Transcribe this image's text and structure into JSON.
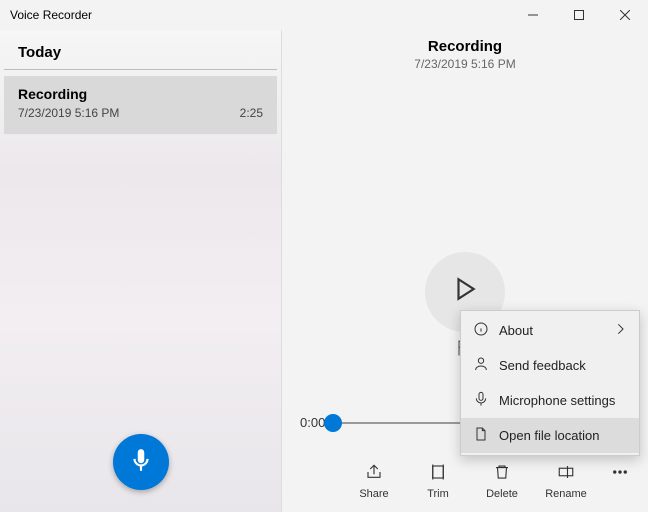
{
  "app_title": "Voice Recorder",
  "sidebar": {
    "group_label": "Today",
    "items": [
      {
        "title": "Recording",
        "subtitle": "7/23/2019 5:16 PM",
        "duration": "2:25"
      }
    ]
  },
  "main": {
    "title": "Recording",
    "subtitle": "7/23/2019 5:16 PM",
    "current_time": "0:00"
  },
  "toolbar": {
    "share": "Share",
    "trim": "Trim",
    "delete": "Delete",
    "rename": "Rename"
  },
  "menu": {
    "about": "About",
    "feedback": "Send feedback",
    "mic": "Microphone settings",
    "open": "Open file location"
  }
}
